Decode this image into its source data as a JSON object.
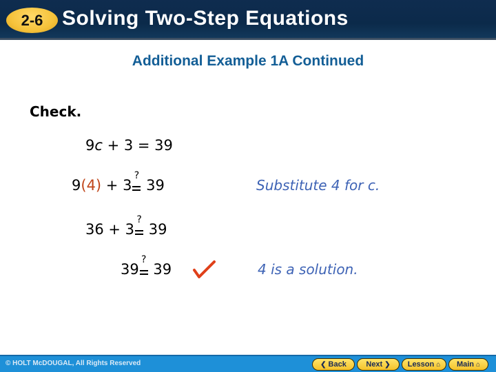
{
  "header": {
    "section_badge": "2-6",
    "title": "Solving Two-Step Equations"
  },
  "slide": {
    "subtitle": "Additional Example 1A Continued",
    "heading": "Check.",
    "steps": [
      {
        "parts": [
          "9",
          "c",
          " + 3 = 39"
        ]
      },
      {
        "parts": [
          "9",
          "(4)",
          " + 3",
          "?",
          " 39"
        ],
        "note": "Substitute 4 for c."
      },
      {
        "parts": [
          "36 + 3",
          "?",
          " 39"
        ]
      },
      {
        "parts": [
          "39",
          "?",
          " 39"
        ],
        "note": "4 is a solution."
      }
    ],
    "check_mark_icon": "check-mark-icon",
    "colors": {
      "substitution": "#c0451a",
      "notes": "#3e63b5",
      "subtitle": "#135e96",
      "check_mark": "#e0401a"
    }
  },
  "footer": {
    "copyright": "© HOLT McDOUGAL, All Rights Reserved",
    "nav": [
      {
        "label": "Back",
        "icon": "chevron-left-icon"
      },
      {
        "label": "Next",
        "icon": "chevron-right-icon"
      },
      {
        "label": "Lesson",
        "icon": "home-icon"
      },
      {
        "label": "Main",
        "icon": "home-icon"
      }
    ]
  }
}
